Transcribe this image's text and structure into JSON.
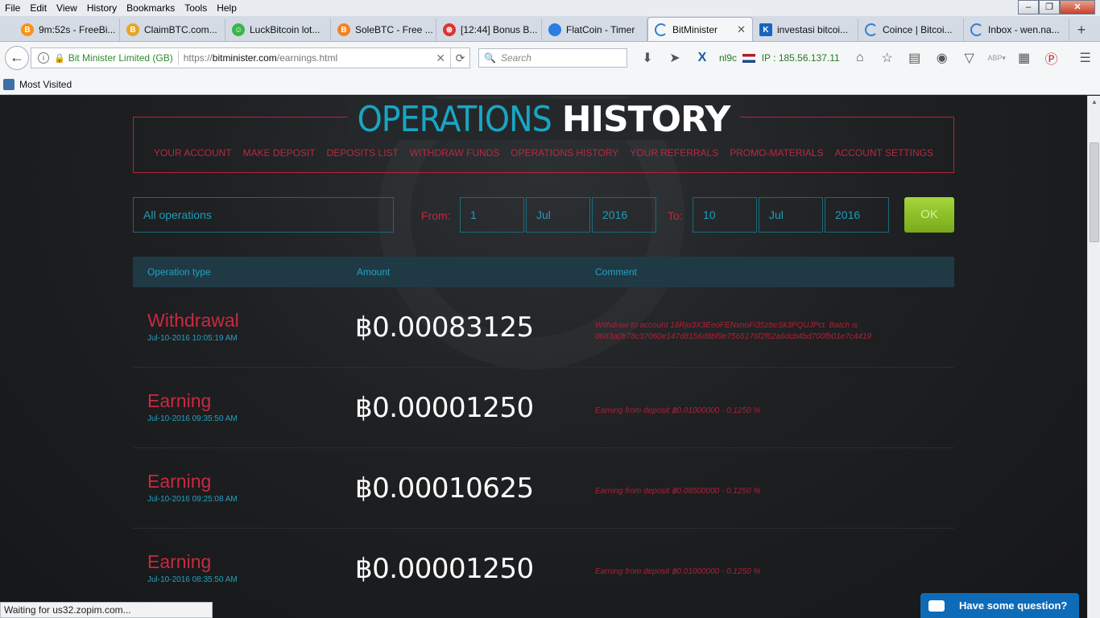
{
  "browser": {
    "menu": [
      "File",
      "Edit",
      "View",
      "History",
      "Bookmarks",
      "Tools",
      "Help"
    ],
    "tabs": [
      {
        "label": "9m:52s - FreeBi...",
        "favicon_color": "#f7931a",
        "favicon_icon": "bitcoin-icon"
      },
      {
        "label": "ClaimBTC.com...",
        "favicon_color": "#e7a521",
        "favicon_icon": "bitcoin-icon"
      },
      {
        "label": "LuckBitcoin lot...",
        "favicon_color": "#3bb54a",
        "favicon_icon": "smiley-icon"
      },
      {
        "label": "SoleBTC - Free ...",
        "favicon_color": "#f58220",
        "favicon_icon": "bitcoin-icon"
      },
      {
        "label": "[12:44] Bonus B...",
        "favicon_color": "#d33",
        "favicon_icon": "grid-icon"
      },
      {
        "label": "FlatCoin - Timer",
        "favicon_color": "#2a7de1",
        "favicon_icon": "coin-icon"
      },
      {
        "label": "BitMinister",
        "favicon_color": "#2f7fd6",
        "favicon_icon": "loading-icon",
        "active": true
      },
      {
        "label": "investasi bitcoi...",
        "favicon_color": "#1565c0",
        "favicon_icon": "k-icon"
      },
      {
        "label": "Coince | Bitcoi...",
        "favicon_color": "#2f7fd6",
        "favicon_icon": "loading-icon"
      },
      {
        "label": "Inbox - wen.na...",
        "favicon_color": "#2f7fd6",
        "favicon_icon": "loading-icon"
      }
    ],
    "url": {
      "org": "Bit Minister Limited (GB)",
      "protocol": "https://",
      "host": "bitminister.com",
      "path": "/earnings.html"
    },
    "search_placeholder": "Search",
    "toolbar_text": {
      "nl_label": "nl9c",
      "ip": "IP : 185.56.137.11",
      "x_label": "X"
    },
    "bookmarks_label": "Most Visited",
    "status_text": "Waiting for us32.zopim.com..."
  },
  "page": {
    "title_light": "OPERATIONS",
    "title_bold": "HISTORY",
    "nav": [
      "YOUR ACCOUNT",
      "MAKE DEPOSIT",
      "DEPOSITS LIST",
      "WITHDRAW FUNDS",
      "OPERATIONS HISTORY",
      "YOUR REFERRALS",
      "PROMO-MATERIALS",
      "ACCOUNT SETTINGS"
    ],
    "filter": {
      "operation": "All operations",
      "from_label": "From:",
      "from_day": "1",
      "from_month": "Jul",
      "from_year": "2016",
      "to_label": "To:",
      "to_day": "10",
      "to_month": "Jul",
      "to_year": "2016",
      "ok_label": "OK"
    },
    "table_headers": {
      "type": "Operation type",
      "amount": "Amount",
      "comment": "Comment"
    },
    "operations": [
      {
        "type": "Withdrawal",
        "date": "Jul-10-2016 10:05:19 AM",
        "amount": "฿0.00083125",
        "comment": "Withdraw to account 18Rju3X3EeoFENxnoFi35zbeSk3PQUJPct. Batch is 0683a0b78c37060e147d8156d8bf9e7565176f2f62a6dcb4bd700fb01e7c4419"
      },
      {
        "type": "Earning",
        "date": "Jul-10-2016 09:35:50 AM",
        "amount": "฿0.00001250",
        "comment": "Earning from deposit ฿0.01000000 - 0.1250 %"
      },
      {
        "type": "Earning",
        "date": "Jul-10-2016 09:25:08 AM",
        "amount": "฿0.00010625",
        "comment": "Earning from deposit ฿0.08500000 - 0.1250 %"
      },
      {
        "type": "Earning",
        "date": "Jul-10-2016 08:35:50 AM",
        "amount": "฿0.00001250",
        "comment": "Earning from deposit ฿0.01000000 - 0.1250 %"
      }
    ],
    "chat_label": "Have some question?"
  }
}
